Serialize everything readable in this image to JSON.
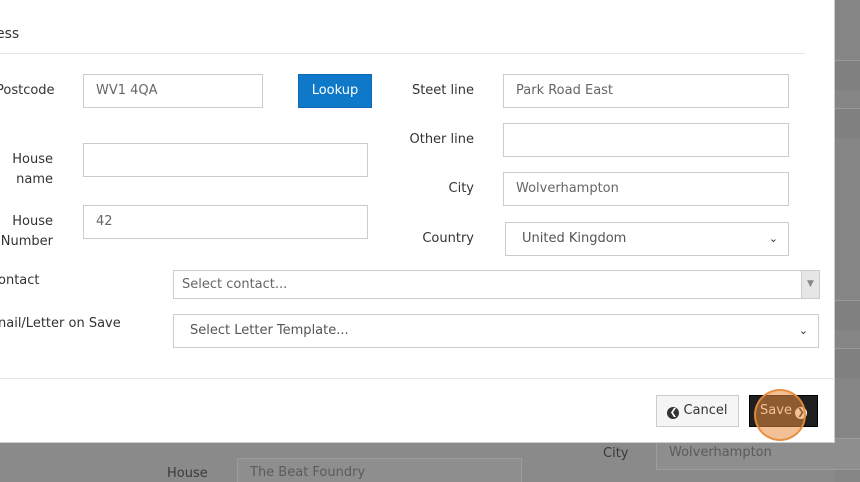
{
  "modal": {
    "title": "ess",
    "fields": {
      "postcode": {
        "label": "Postcode",
        "value": "WV1 4QA"
      },
      "lookup_label": "Lookup",
      "house_name": {
        "label_line1": "House",
        "label_line2": "name",
        "value": ""
      },
      "house_number": {
        "label_line1": "House",
        "label_line2": "Number",
        "value": "42"
      },
      "street_line": {
        "label": "Steet line",
        "value": "Park Road East"
      },
      "other_line": {
        "label": "Other line",
        "value": ""
      },
      "city": {
        "label": "City",
        "value": "Wolverhampton"
      },
      "country": {
        "label": "Country",
        "value": "United Kingdom"
      },
      "contact": {
        "label": "ontact",
        "placeholder": "Select contact..."
      },
      "email_letter": {
        "label": "nail/Letter on Save",
        "placeholder": "Select Letter Template..."
      }
    },
    "buttons": {
      "cancel_label": "Cancel",
      "save_label": "Save"
    }
  },
  "background": {
    "city_label": "City",
    "city_value": "Wolverhampton",
    "house_label": "House",
    "house_value": "The Beat Foundry"
  },
  "icons": {
    "cancel": "arrow-left-circle-icon",
    "save": "arrow-right-circle-icon",
    "select_chevron": "chevron-down-icon"
  },
  "colors": {
    "primary": "#0f79c9",
    "save_button": "#1f1f1f",
    "click_marker": "#e88c3c"
  }
}
